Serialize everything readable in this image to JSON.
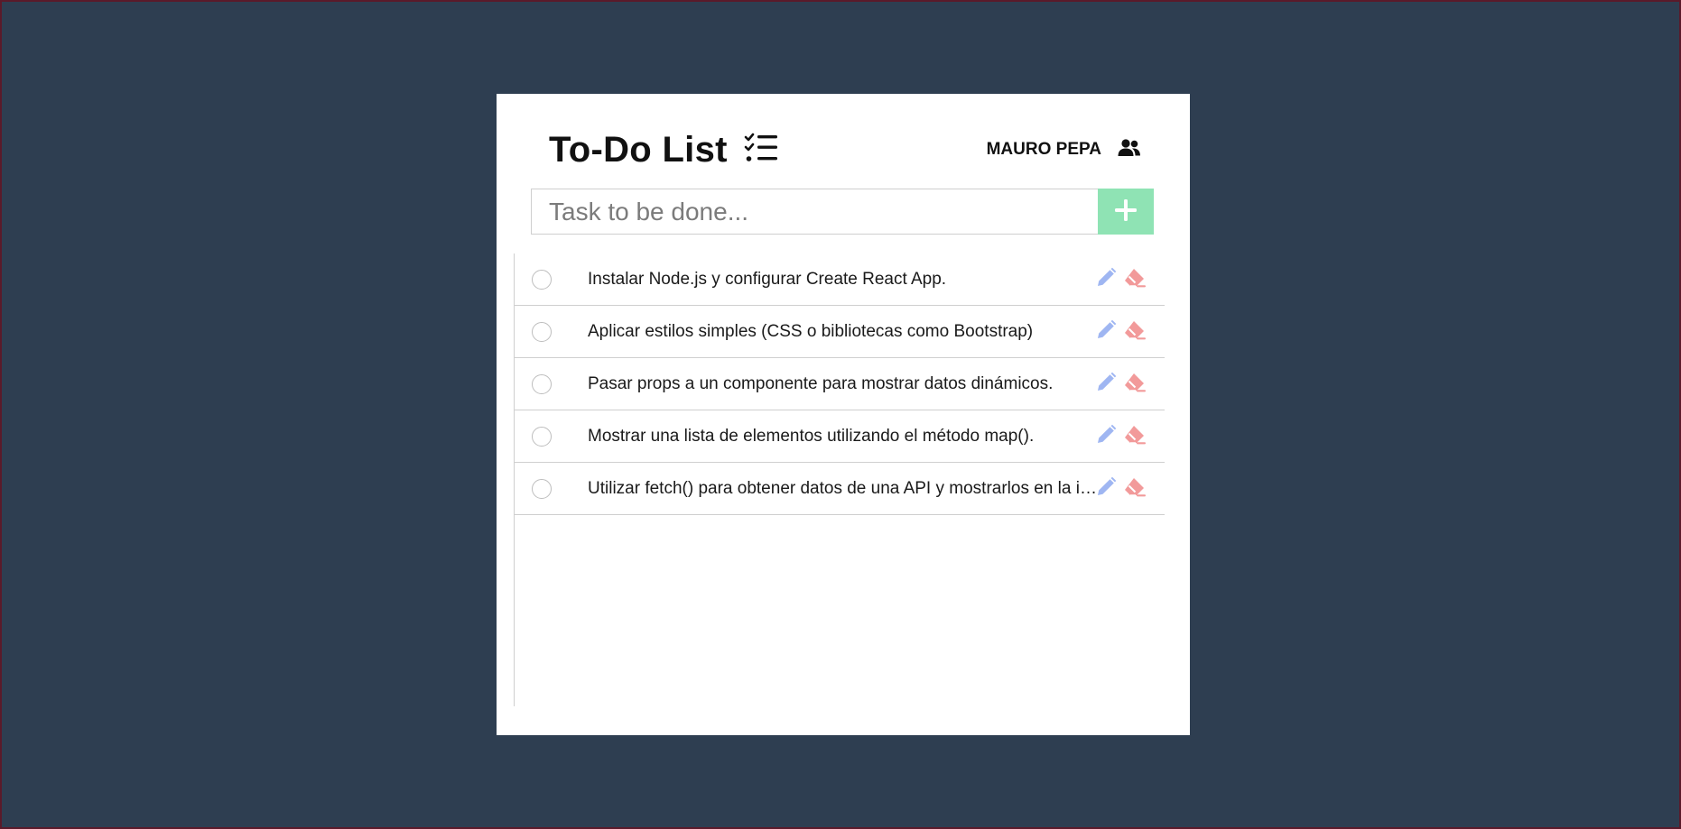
{
  "app": {
    "title": "To-Do List",
    "user_name": "MAURO PEPA"
  },
  "input": {
    "placeholder": "Task to be done...",
    "value": ""
  },
  "tasks": [
    {
      "text": "Instalar Node.js y configurar Create React App."
    },
    {
      "text": "Aplicar estilos simples (CSS o bibliotecas como Bootstrap)"
    },
    {
      "text": "Pasar props a un componente para mostrar datos dinámicos."
    },
    {
      "text": "Mostrar una lista de elementos utilizando el método map()."
    },
    {
      "text": "Utilizar fetch() para obtener datos de una API y mostrarlos en la interfaz."
    }
  ],
  "colors": {
    "background": "#2e3e51",
    "card": "#ffffff",
    "add_button": "#8fe3b4",
    "edit_icon": "#9fb6f2",
    "delete_icon": "#f29a9a"
  },
  "icons": {
    "title_icon": "list-check-icon",
    "user_icon": "users-icon",
    "add_icon": "plus-icon",
    "edit_icon": "pencil-icon",
    "delete_icon": "eraser-icon"
  }
}
